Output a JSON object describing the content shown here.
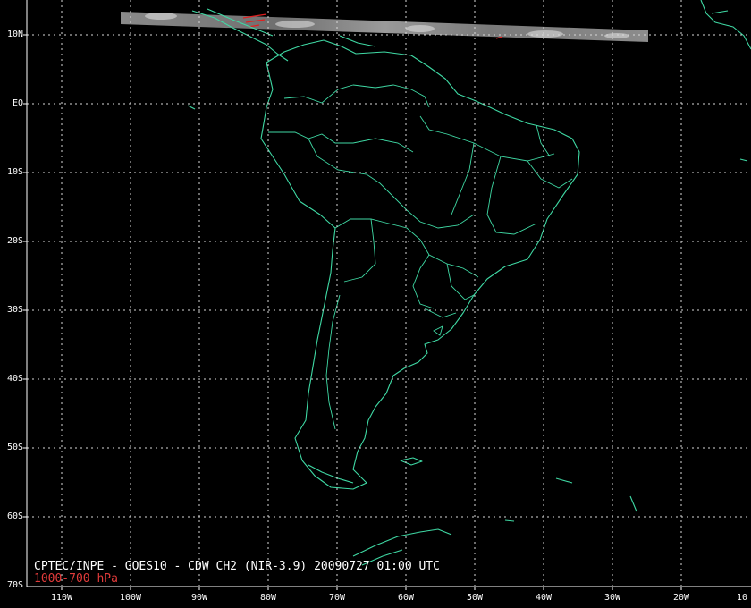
{
  "caption": "CPTEC/INPE - GOES10 - CDW CH2 (NIR-3.9) 20090727 01:00 UTC",
  "level": "1000-700 hPa",
  "colors": {
    "coast": "#3fd9a4",
    "grid": "#d8d8d8",
    "vectors": "#e02020",
    "frame": "#ffffff",
    "level_text": "#e23b3b"
  },
  "lat_labels": [
    "10N",
    "EQ",
    "10S",
    "20S",
    "30S",
    "40S",
    "50S",
    "60S",
    "70S"
  ],
  "lon_labels": [
    "110W",
    "100W",
    "90W",
    "80W",
    "70W",
    "60W",
    "50W",
    "40W",
    "30W",
    "20W",
    "10"
  ]
}
